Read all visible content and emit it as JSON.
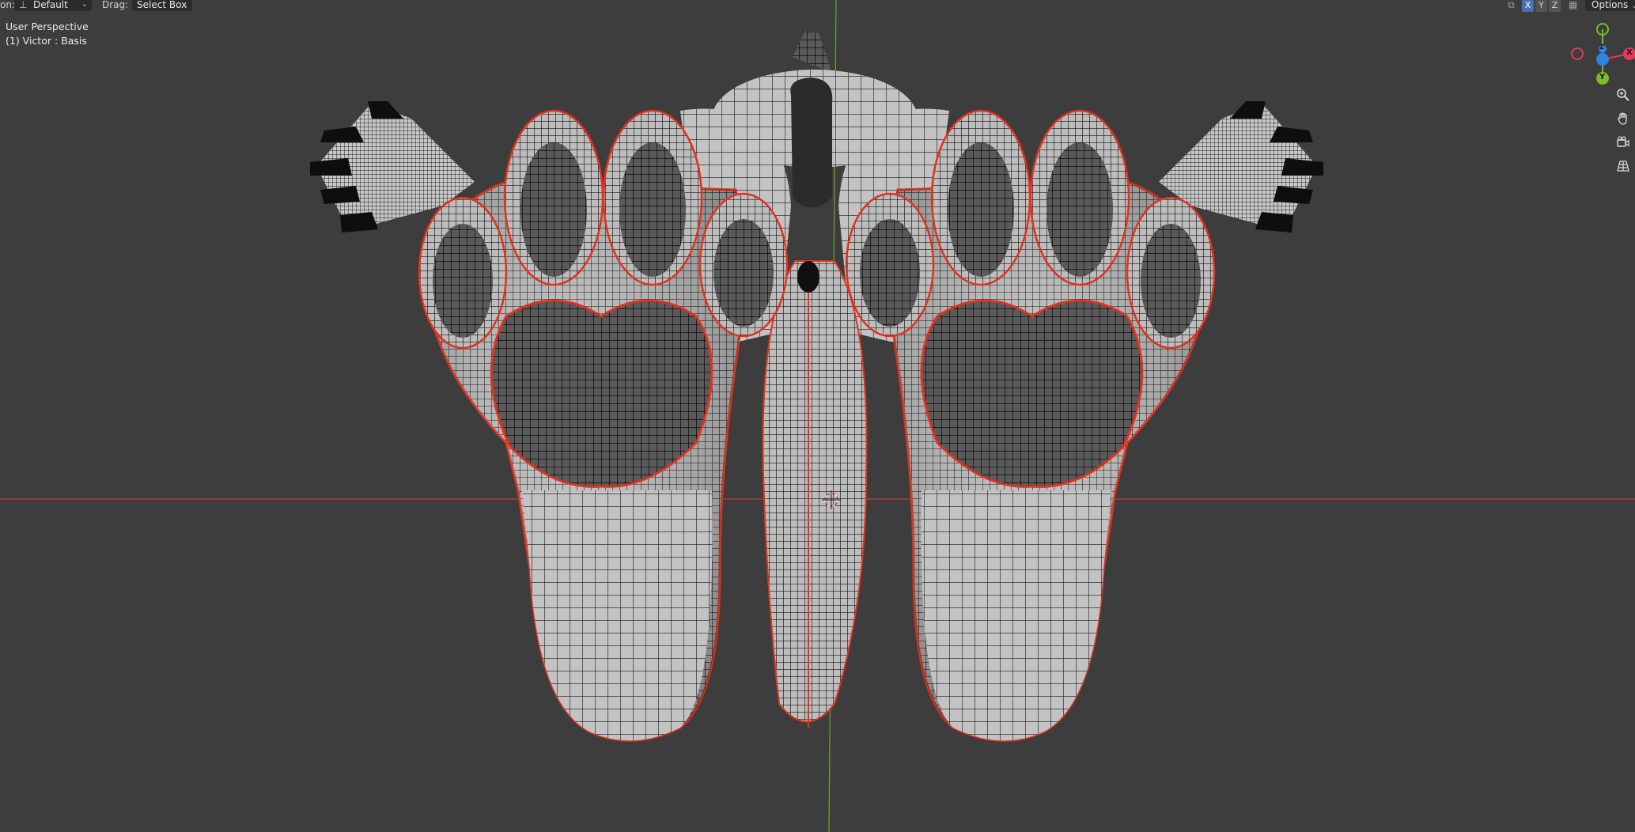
{
  "header": {
    "orientation_label_fragment": "on:",
    "orientation_value": "Default",
    "drag_label": "Drag:",
    "drag_value": "Select Box",
    "axis_toggles": [
      "X",
      "Y",
      "Z"
    ],
    "options_label": "Options"
  },
  "viewport": {
    "view_name": "User Perspective",
    "object_info": "(1) Victor : Basis"
  },
  "gizmo": {
    "axes": [
      {
        "label": "X",
        "color": "#e6385a"
      },
      {
        "label": "Y",
        "color": "#7cbb25"
      },
      {
        "label": "Z",
        "color": "#2f83e0"
      }
    ]
  },
  "nav_controls": [
    "zoom-icon",
    "hand-pan-icon",
    "camera-icon",
    "grid-perspective-icon"
  ],
  "colors": {
    "background": "#3d3d3d",
    "mesh_surface": "#b9b9b9",
    "wire": "#111111",
    "seam": "#e0321f",
    "x_axis_line": "#c23b3b",
    "y_axis_line": "#6ea82a"
  }
}
